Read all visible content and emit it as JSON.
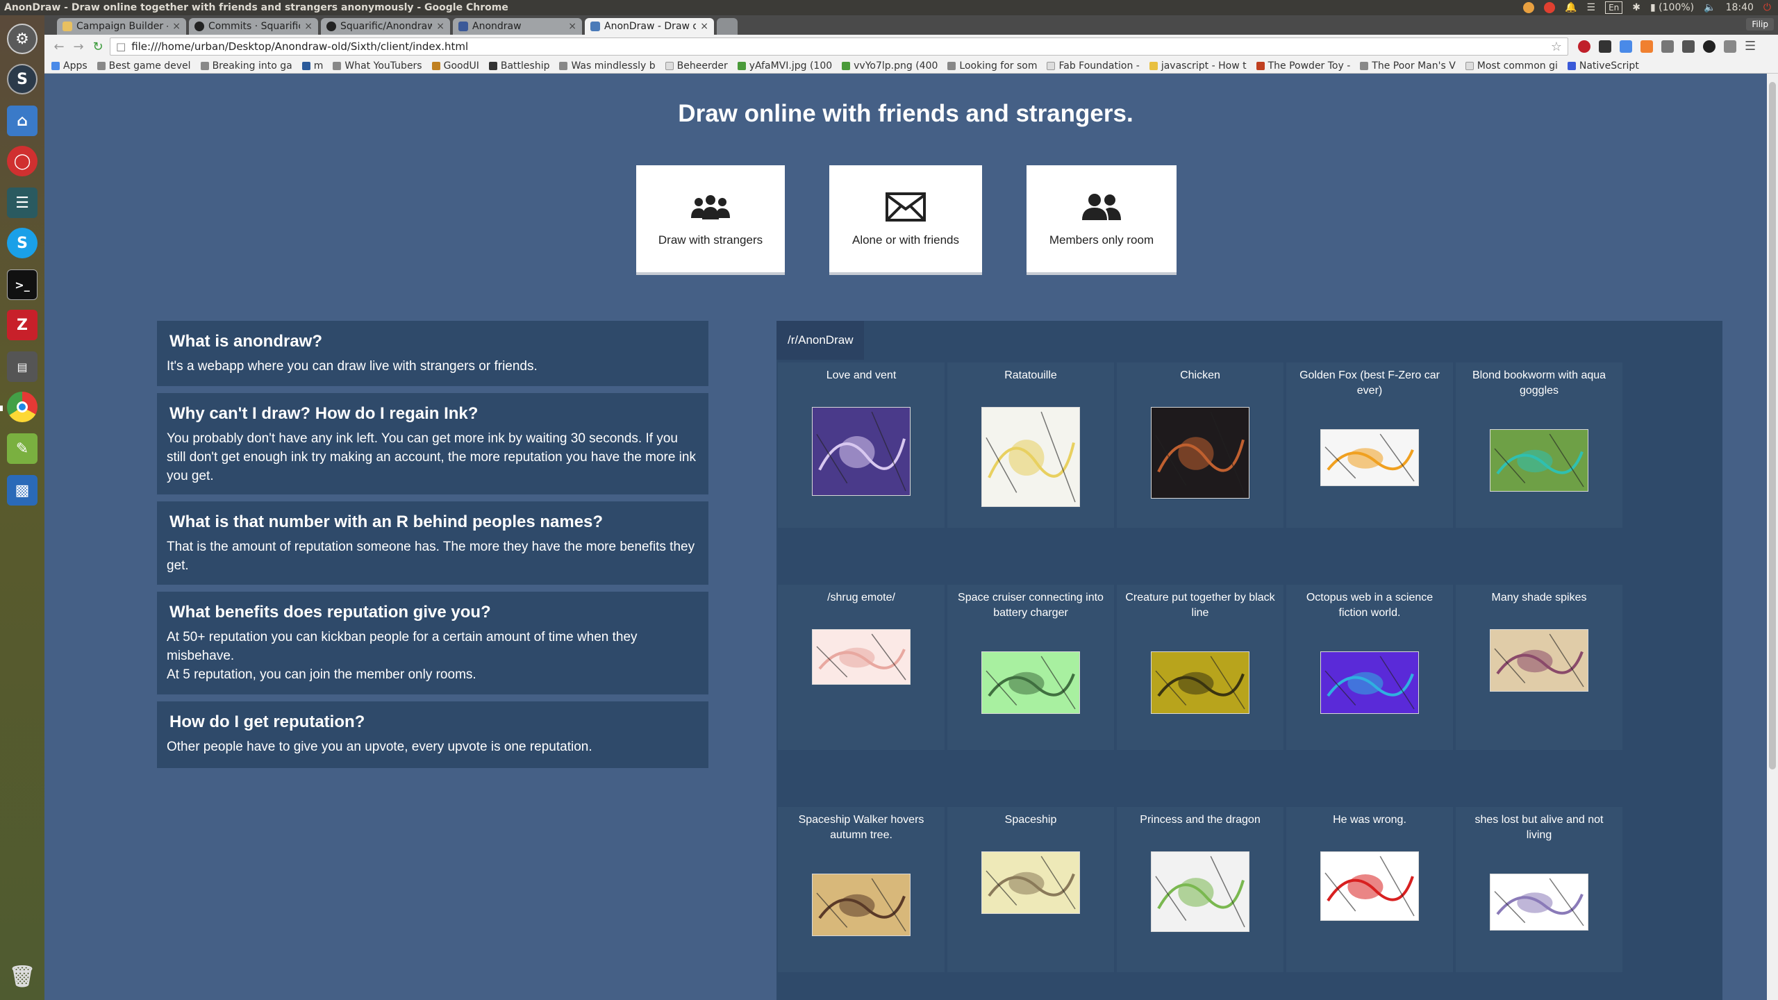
{
  "os": {
    "window_title": "AnonDraw - Draw online together with friends and strangers anonymously - Google Chrome",
    "battery": "(100%)",
    "time": "18:40",
    "keyboard": "En"
  },
  "browser": {
    "tabs": [
      {
        "label": "Campaign Builder - ",
        "active": false
      },
      {
        "label": "Commits · Squarific/",
        "active": false
      },
      {
        "label": "Squarific/Anondraw",
        "active": false
      },
      {
        "label": "Anondraw",
        "active": false
      },
      {
        "label": "AnonDraw - Draw o",
        "active": true
      }
    ],
    "profile": "Filip",
    "url": "file:///home/urban/Desktop/Anondraw-old/Sixth/client/index.html",
    "bookmarks": [
      "Apps",
      "Best game devel",
      "Breaking into ga",
      "m",
      "What YouTubers",
      "GoodUI",
      "Battleship",
      "Was mindlessly b",
      "Beheerder",
      "yAfaMVI.jpg (100",
      "vvYo7lp.png (400",
      "Looking for som",
      "Fab Foundation -",
      "javascript - How t",
      "The Powder Toy -",
      "The Poor Man's V",
      "Most common gi",
      "NativeScript"
    ]
  },
  "page": {
    "headline": "Draw online with friends and strangers.",
    "modes": [
      {
        "icon": "group-icon",
        "label": "Draw with strangers"
      },
      {
        "icon": "envelope-icon",
        "label": "Alone or with friends"
      },
      {
        "icon": "users-icon",
        "label": "Members only room"
      }
    ],
    "faq": [
      {
        "q": "What is anondraw?",
        "a": [
          "It's a webapp where you can draw live with strangers or friends."
        ]
      },
      {
        "q": "Why can't I draw? How do I regain Ink?",
        "a": [
          "You probably don't have any ink left. You can get more ink by waiting 30 seconds. If you still don't get enough ink try making an account, the more reputation you have the more ink you get."
        ]
      },
      {
        "q": "What is that number with an R behind peoples names?",
        "a": [
          "That is the amount of reputation someone has. The more they have the more benefits they get."
        ]
      },
      {
        "q": "What benefits does reputation give you?",
        "a": [
          "At 50+ reputation you can kickban people for a certain amount of time when they misbehave.",
          "At 5 reputation, you can join the member only rooms."
        ]
      },
      {
        "q": "How do I get reputation?",
        "a": [
          "Other people have to give you an upvote, every upvote is one reputation."
        ]
      }
    ],
    "reddit": {
      "title": "/r/AnonDraw",
      "posts": [
        {
          "title": "Love and vent",
          "bg": "#4a3a8a",
          "accent": "#d8c8f0"
        },
        {
          "title": "Ratatouille",
          "bg": "#f4f4ee",
          "accent": "#e8d060"
        },
        {
          "title": "Chicken",
          "bg": "#1e1a1c",
          "accent": "#c06030"
        },
        {
          "title": "Golden Fox (best F-Zero car ever)",
          "bg": "#f6f6f6",
          "accent": "#f0a020"
        },
        {
          "title": "Blond bookworm with aqua goggles",
          "bg": "#6ea046",
          "accent": "#30c0b0"
        },
        {
          "title": "/shrug emote/",
          "bg": "#fbe9e6",
          "accent": "#e8a8a0"
        },
        {
          "title": "Space cruiser connecting into battery charger",
          "bg": "#a8f0a0",
          "accent": "#407040"
        },
        {
          "title": "Creature put together by black line",
          "bg": "#b8a41c",
          "accent": "#3a3410"
        },
        {
          "title": "Octopus web in a science fiction world.",
          "bg": "#5a2ad8",
          "accent": "#30b0e0"
        },
        {
          "title": "Many shade spikes",
          "bg": "#e0cca8",
          "accent": "#8a4a6a"
        },
        {
          "title": "Spaceship Walker hovers autumn tree.",
          "bg": "#d8b87a",
          "accent": "#5a3a28"
        },
        {
          "title": "Spaceship",
          "bg": "#eee9b8",
          "accent": "#8a7a5a"
        },
        {
          "title": "Princess and the dragon",
          "bg": "#f2f2f2",
          "accent": "#7ab850"
        },
        {
          "title": "He was wrong.",
          "bg": "#ffffff",
          "accent": "#d82020"
        },
        {
          "title": "shes lost but alive and not living",
          "bg": "#ffffff",
          "accent": "#8a7ab8"
        }
      ]
    }
  },
  "colors": {
    "page_bg": "#456086",
    "panel_bg": "#2f4a6a",
    "tile_bg": "#34506f"
  }
}
